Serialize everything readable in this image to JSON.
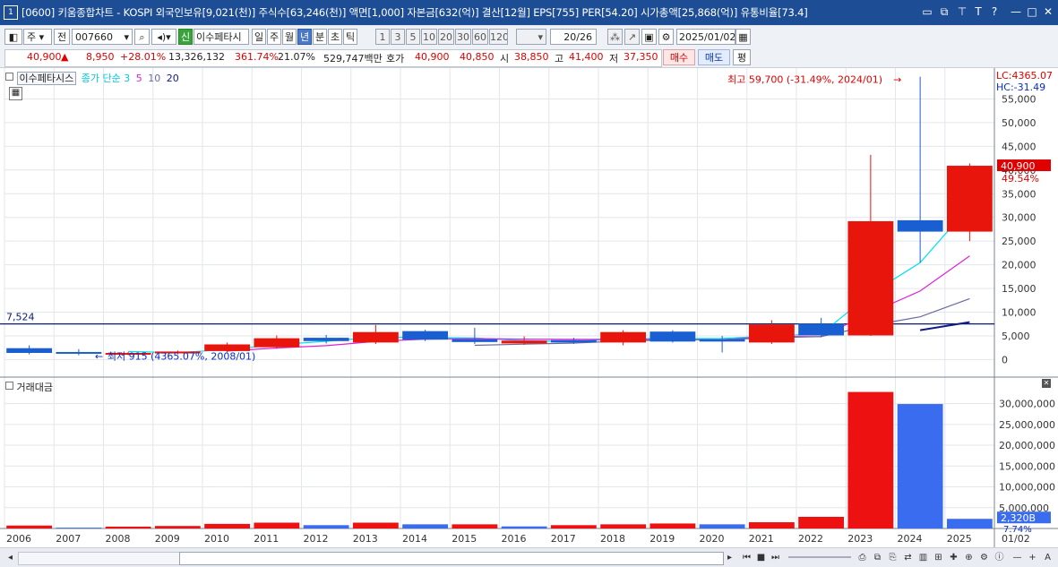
{
  "window": {
    "title": "[0600] 키움종합차트 - KOSPI 외국인보유[9,021(천)] 주식수[63,246(천)] 액면[1,000] 자본금[632(억)] 결산[12월] EPS[755] PER[54.20] 시가총액[25,868(억)] 유통비율[73.4]",
    "badge": "1"
  },
  "toolbar": {
    "period_select": "주",
    "all_label": "전",
    "code": "007660",
    "new_badge": "신",
    "stock_name": "이수페타시",
    "periods": [
      "일",
      "주",
      "월",
      "년",
      "분",
      "초",
      "틱"
    ],
    "active_period": "년",
    "intervals": [
      "1",
      "3",
      "5",
      "10",
      "20",
      "30",
      "60",
      "120"
    ],
    "count": "20/26",
    "date": "2025/01/02"
  },
  "quote": {
    "price": "40,900",
    "up_arrow": "▲",
    "change": "8,950",
    "change_pct": "+28.01%",
    "volume": "13,326,132",
    "ratio1": "361.74%",
    "ratio2": "21.07%",
    "amount": "529,747백만",
    "ask_label": "호가",
    "ask1": "40,900",
    "ask2": "40,850",
    "open_label": "시",
    "open": "38,850",
    "high_label": "고",
    "high": "41,400",
    "low_label": "저",
    "low": "37,350",
    "buy": "매수",
    "sell": "매도",
    "eval": "평"
  },
  "legend": {
    "name": "이수페타시스",
    "ma_label": "종가 단순",
    "ma_periods": [
      "3",
      "5",
      "10",
      "20"
    ],
    "volume_label": "거래대금"
  },
  "colors": {
    "up": "#e8150c",
    "down": "#1a5fd1",
    "vol_up": "#ee1111",
    "vol_down": "#3a6cf0",
    "ma3": "#00e0f0",
    "ma5": "#e020d8",
    "ma10": "#6a6a9e",
    "ma20": "#101a8a"
  },
  "annotations": {
    "max_label": "최고 59,700 (-31.49%, 2024/01)",
    "min_label": "최저 915 (4365.07%, 2008/01)",
    "lc": "LC:4365.07",
    "hc": "HC:-31.49",
    "ref_line": "7,524",
    "last_price": "40,900",
    "last_pct": "49.54%",
    "last_volume": "2,320B",
    "last_vol_pct": "7.74%",
    "last_date": "01/02"
  },
  "chart_data": [
    {
      "type": "candlestick",
      "years": [
        "2006",
        "2007",
        "2008",
        "2009",
        "2010",
        "2011",
        "2012",
        "2013",
        "2014",
        "2015",
        "2016",
        "2017",
        "2018",
        "2019",
        "2020",
        "2021",
        "2022",
        "2023",
        "2024",
        "2025"
      ],
      "open": [
        2400,
        1600,
        1100,
        1300,
        1800,
        2600,
        4600,
        3600,
        6000,
        4300,
        3400,
        4100,
        3600,
        5900,
        4300,
        3600,
        7600,
        5100,
        29400,
        27000
      ],
      "close": [
        1400,
        1300,
        1400,
        1700,
        3200,
        4500,
        3900,
        5800,
        4200,
        3700,
        4000,
        3600,
        5800,
        3800,
        3800,
        7400,
        5100,
        29200,
        27000,
        40900
      ],
      "high": [
        3000,
        2200,
        1600,
        1900,
        3600,
        5100,
        5200,
        7300,
        6300,
        6700,
        4900,
        4600,
        6200,
        6200,
        5000,
        8300,
        8800,
        43200,
        59700,
        41400
      ],
      "low": [
        1100,
        900,
        915,
        1100,
        1500,
        2300,
        3400,
        3300,
        3900,
        3300,
        3100,
        3300,
        3000,
        3600,
        1500,
        3300,
        4700,
        5000,
        20500,
        25000
      ],
      "ma": [
        {
          "name": "3",
          "values": [
            null,
            null,
            1700,
            1467,
            2100,
            3133,
            3867,
            4733,
            4633,
            4567,
            3967,
            3767,
            4467,
            4400,
            4467,
            5000,
            5433,
            13900,
            20433,
            32367
          ]
        },
        {
          "name": "5",
          "values": [
            null,
            null,
            null,
            null,
            1800,
            2440,
            2940,
            3820,
            4320,
            4420,
            4320,
            4260,
            4280,
            4180,
            4200,
            4880,
            4820,
            9860,
            14460,
            21880
          ]
        },
        {
          "name": "10",
          "values": [
            null,
            null,
            null,
            null,
            null,
            null,
            null,
            null,
            null,
            3000,
            3250,
            3480,
            3920,
            4140,
            4210,
            4600,
            4840,
            7180,
            9020,
            12860
          ]
        },
        {
          "name": "20",
          "values": [
            null,
            null,
            null,
            null,
            null,
            null,
            null,
            null,
            null,
            null,
            null,
            null,
            null,
            null,
            null,
            null,
            null,
            null,
            6200,
            7900
          ]
        }
      ],
      "y_ticks": [
        "55,000",
        "50,000",
        "45,000",
        "40,000",
        "35,000",
        "30,000",
        "25,000",
        "20,000",
        "15,000",
        "10,000",
        "5,000",
        "0"
      ],
      "ylim": [
        -2000,
        60000
      ]
    },
    {
      "type": "bar",
      "name": "거래대금",
      "categories": [
        "2006",
        "2007",
        "2008",
        "2009",
        "2010",
        "2011",
        "2012",
        "2013",
        "2014",
        "2015",
        "2016",
        "2017",
        "2018",
        "2019",
        "2020",
        "2021",
        "2022",
        "2023",
        "2024",
        "2025"
      ],
      "values": [
        700000000,
        200000000,
        450000000,
        600000000,
        1100000000,
        1400000000,
        800000000,
        1400000000,
        1000000000,
        1000000000,
        500000000,
        800000000,
        1000000000,
        1200000000,
        1000000000,
        1500000000,
        2800000000,
        32800000000,
        29900000000,
        2320000000
      ],
      "up": [
        true,
        false,
        true,
        true,
        true,
        true,
        false,
        true,
        false,
        true,
        false,
        true,
        true,
        true,
        false,
        true,
        true,
        true,
        false,
        false
      ],
      "y_ticks": [
        "30,000,000",
        "25,000,000",
        "20,000,000",
        "15,000,000",
        "10,000,000",
        "5,000,000"
      ],
      "ylim": [
        0,
        34000000000
      ]
    }
  ]
}
